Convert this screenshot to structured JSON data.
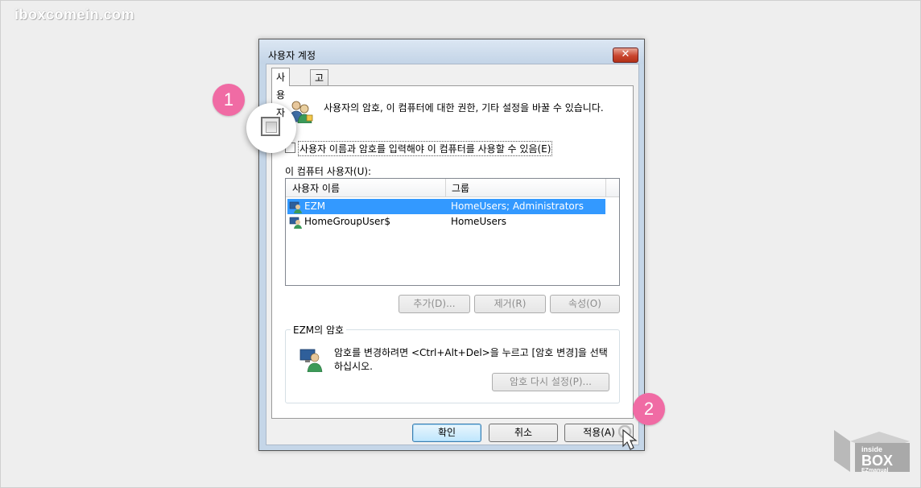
{
  "watermark": "iboxcomein.com",
  "dialog": {
    "title": "사용자 계정",
    "close_glyph": "✕",
    "tabs": [
      {
        "label": "사용자",
        "active": true
      },
      {
        "label": "고급",
        "active": false
      }
    ],
    "info_text": "사용자의 암호, 이 컴퓨터에 대한  권한, 기타 설정을 바꿀 수 있습니다.",
    "require_login_checkbox": {
      "label": "사용자 이름과 암호를 입력해야 이 컴퓨터를 사용할 수 있음(E)",
      "checked": false
    },
    "users_label": "이 컴퓨터 사용자(U):",
    "user_list": {
      "columns": [
        "사용자 이름",
        "그룹"
      ],
      "rows": [
        {
          "name": "EZM",
          "group": "HomeUsers; Administrators",
          "selected": true
        },
        {
          "name": "HomeGroupUser$",
          "group": "HomeUsers",
          "selected": false
        }
      ]
    },
    "list_buttons": {
      "add": "추가(D)...",
      "remove": "제거(R)",
      "properties": "속성(O)"
    },
    "password_group": {
      "title": "EZM의 암호",
      "text": "암호를 변경하려면 <Ctrl+Alt+Del>을 누르고 [암호 변경]을 선택하십시오.",
      "reset_button": "암호 다시 설정(P)..."
    },
    "footer_buttons": {
      "ok": "확인",
      "cancel": "취소",
      "apply": "적용(A)"
    }
  },
  "callouts": {
    "step1": "1",
    "step2": "2"
  },
  "logo": {
    "line1": "inside",
    "line2": "BOX",
    "line3": "EZmanual"
  },
  "colors": {
    "badge": "#f06ba4",
    "selection": "#3399ff",
    "titlebar": "#c5d6e8",
    "close_button": "#c9452f"
  }
}
